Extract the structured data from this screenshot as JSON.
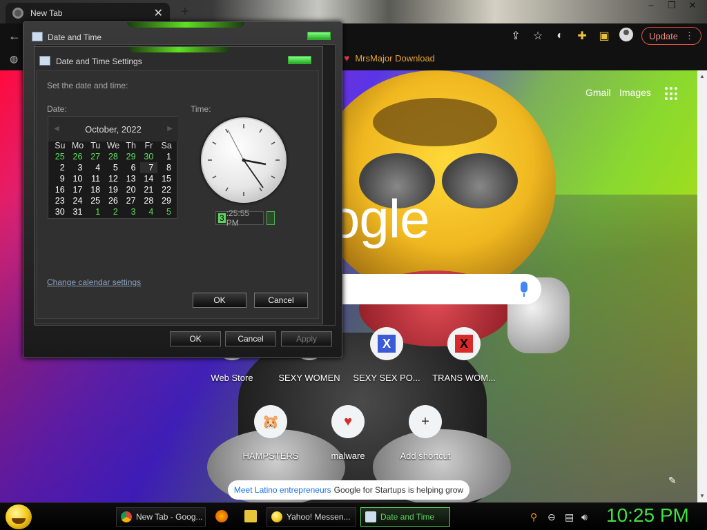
{
  "browser": {
    "tab_title": "New Tab",
    "update_label": "Update",
    "bookmark_label": "MrsMajor Download"
  },
  "ntp": {
    "gmail": "Gmail",
    "images": "Images",
    "logo_text": "ogle",
    "shortcuts": [
      {
        "label": "Web Store"
      },
      {
        "label": "SEXY WOMEN"
      },
      {
        "label": "SEXY SEX PO..."
      },
      {
        "label": "TRANS WOM..."
      },
      {
        "label": "HAMPSTERS"
      },
      {
        "label": "malware"
      },
      {
        "label": "Add shortcut"
      }
    ],
    "promo_link": "Meet Latino entrepreneurs",
    "promo_text": "Google for Startups is helping grow"
  },
  "outer_dialog": {
    "title": "Date and Time",
    "ok": "OK",
    "cancel": "Cancel",
    "apply": "Apply"
  },
  "inner_dialog": {
    "title": "Date and Time Settings",
    "instruction": "Set the date and time:",
    "date_label": "Date:",
    "time_label": "Time:",
    "month_year": "October, 2022",
    "weekdays": [
      "Su",
      "Mo",
      "Tu",
      "We",
      "Th",
      "Fr",
      "Sa"
    ],
    "weeks": [
      [
        "25",
        "26",
        "27",
        "28",
        "29",
        "30",
        "1"
      ],
      [
        "2",
        "3",
        "4",
        "5",
        "6",
        "7",
        "8"
      ],
      [
        "9",
        "10",
        "11",
        "12",
        "13",
        "14",
        "15"
      ],
      [
        "16",
        "17",
        "18",
        "19",
        "20",
        "21",
        "22"
      ],
      [
        "23",
        "24",
        "25",
        "26",
        "27",
        "28",
        "29"
      ],
      [
        "30",
        "31",
        "1",
        "2",
        "3",
        "4",
        "5"
      ]
    ],
    "selected_day": "7",
    "time_hour": "3",
    "time_rest": ":25:55 PM",
    "change_calendar": "Change calendar settings",
    "ok": "OK",
    "cancel": "Cancel"
  },
  "taskbar": {
    "items": [
      {
        "label": "New Tab - Goog..."
      },
      {
        "label": "Yahoo! Messen..."
      },
      {
        "label": "Date and Time"
      }
    ],
    "clock": "10:25 PM"
  },
  "colors": {
    "accent_green": "#5fd25f",
    "update_red": "#e0533f",
    "bookmark_orange": "#e9a33a"
  }
}
